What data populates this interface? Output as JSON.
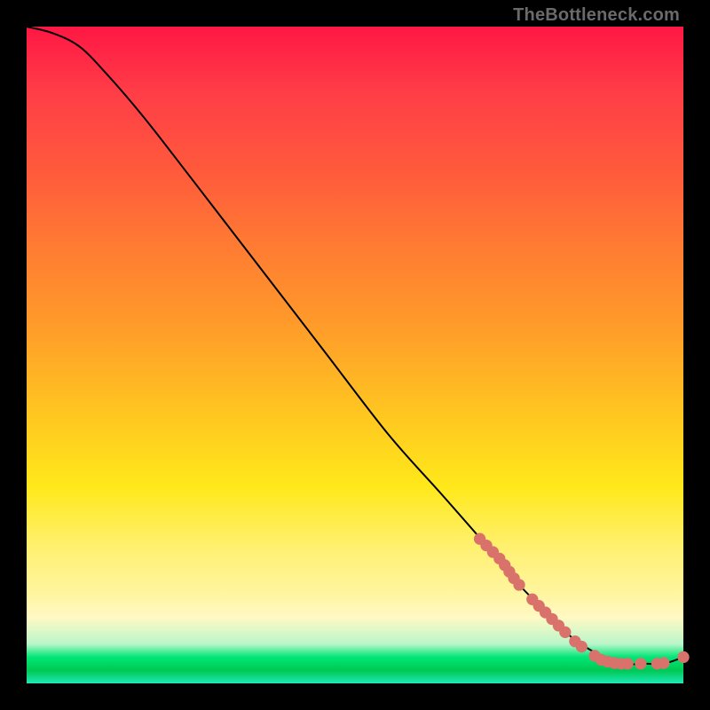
{
  "watermark": "TheBottleneck.com",
  "chart_data": {
    "type": "line",
    "title": "",
    "xlabel": "",
    "ylabel": "",
    "xlim": [
      0,
      100
    ],
    "ylim": [
      0,
      100
    ],
    "grid": false,
    "legend": false,
    "series": [
      {
        "name": "bottleneck-curve",
        "x": [
          0,
          4,
          8,
          12,
          18,
          25,
          35,
          45,
          55,
          63,
          70,
          75,
          80,
          83,
          86,
          90,
          94,
          97,
          100
        ],
        "y": [
          100,
          99,
          97,
          93,
          86,
          77,
          64,
          51,
          38,
          29,
          21,
          15,
          10,
          7,
          5,
          3,
          3,
          3,
          4
        ],
        "stroke": "#000000",
        "width": 2
      }
    ],
    "markers": [
      {
        "name": "highlight-cluster",
        "shape": "circle",
        "color": "#d9726b",
        "radius_pct": 0.9,
        "points": [
          {
            "x": 69,
            "y": 22
          },
          {
            "x": 70,
            "y": 21
          },
          {
            "x": 71,
            "y": 20
          },
          {
            "x": 72,
            "y": 19
          },
          {
            "x": 72.8,
            "y": 18
          },
          {
            "x": 73.5,
            "y": 17
          },
          {
            "x": 74.2,
            "y": 16
          },
          {
            "x": 75,
            "y": 15
          },
          {
            "x": 77,
            "y": 12.8
          },
          {
            "x": 78,
            "y": 11.8
          },
          {
            "x": 79,
            "y": 10.8
          },
          {
            "x": 80,
            "y": 9.8
          },
          {
            "x": 81,
            "y": 8.8
          },
          {
            "x": 82,
            "y": 7.8
          },
          {
            "x": 83.5,
            "y": 6.4
          },
          {
            "x": 84.5,
            "y": 5.6
          },
          {
            "x": 86.5,
            "y": 4.2
          },
          {
            "x": 87.5,
            "y": 3.6
          },
          {
            "x": 88.5,
            "y": 3.3
          },
          {
            "x": 89.5,
            "y": 3.1
          },
          {
            "x": 90.5,
            "y": 3.0
          },
          {
            "x": 91.5,
            "y": 3.0
          },
          {
            "x": 93.5,
            "y": 3.0
          },
          {
            "x": 96,
            "y": 3.0
          },
          {
            "x": 97,
            "y": 3.1
          },
          {
            "x": 100,
            "y": 4.0
          }
        ]
      }
    ]
  }
}
